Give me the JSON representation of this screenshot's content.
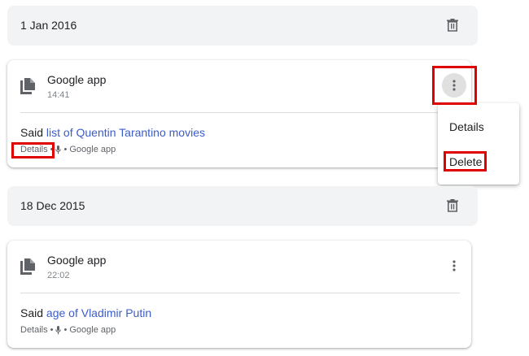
{
  "groups": [
    {
      "date": "1 Jan 2016",
      "card": {
        "app": "Google app",
        "time": "14:41",
        "said_prefix": "Said",
        "query": "list of Quentin Tarantino movies",
        "details": "Details",
        "bullet": "•",
        "source": "Google app"
      }
    },
    {
      "date": "18 Dec 2015",
      "card": {
        "app": "Google app",
        "time": "22:02",
        "said_prefix": "Said",
        "query": "age of Vladimir Putin",
        "details": "Details",
        "bullet": "•",
        "source": "Google app"
      }
    }
  ],
  "menu": {
    "details": "Details",
    "delete": "Delete"
  },
  "icons": {
    "trash": "trash-icon",
    "app": "document-icon",
    "mic": "mic-icon",
    "more": "more-vert-icon"
  },
  "colors": {
    "link": "#3c5cc9",
    "highlight": "#e00000",
    "header_bg": "#f1f3f4"
  }
}
